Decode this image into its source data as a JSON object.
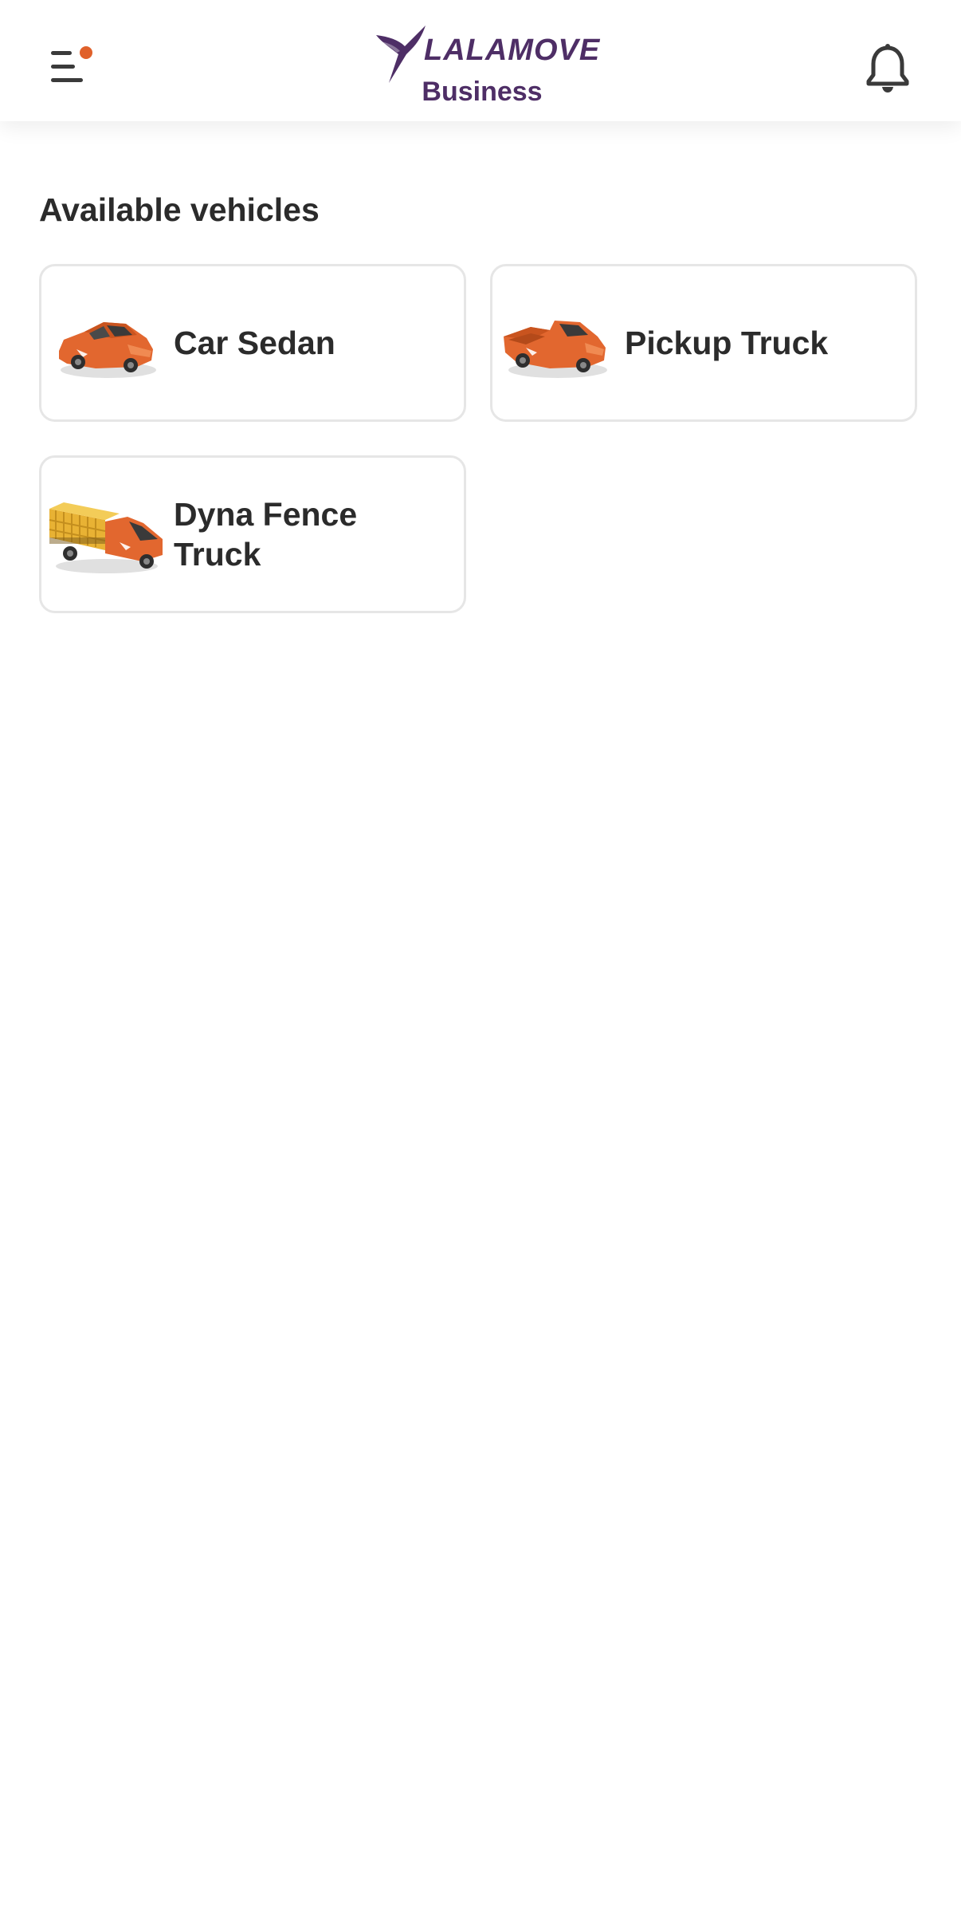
{
  "header": {
    "menu_icon": "hamburger-menu-icon",
    "notification_dot_color": "#e0612b",
    "logo": {
      "brand": "LALAMOVE",
      "subtitle": "Business",
      "color": "#4e2e66"
    },
    "bell_icon": "bell-icon"
  },
  "main": {
    "section_title": "Available vehicles",
    "vehicles": [
      {
        "name": "Car Sedan",
        "icon": "car-sedan-icon"
      },
      {
        "name": "Pickup Truck",
        "icon": "pickup-truck-icon"
      },
      {
        "name": "Dyna Fence Truck",
        "icon": "dyna-fence-truck-icon"
      }
    ]
  },
  "colors": {
    "vehicle_orange": "#e2672f",
    "text": "#2b2b2b",
    "card_border": "#e6e6e6"
  }
}
